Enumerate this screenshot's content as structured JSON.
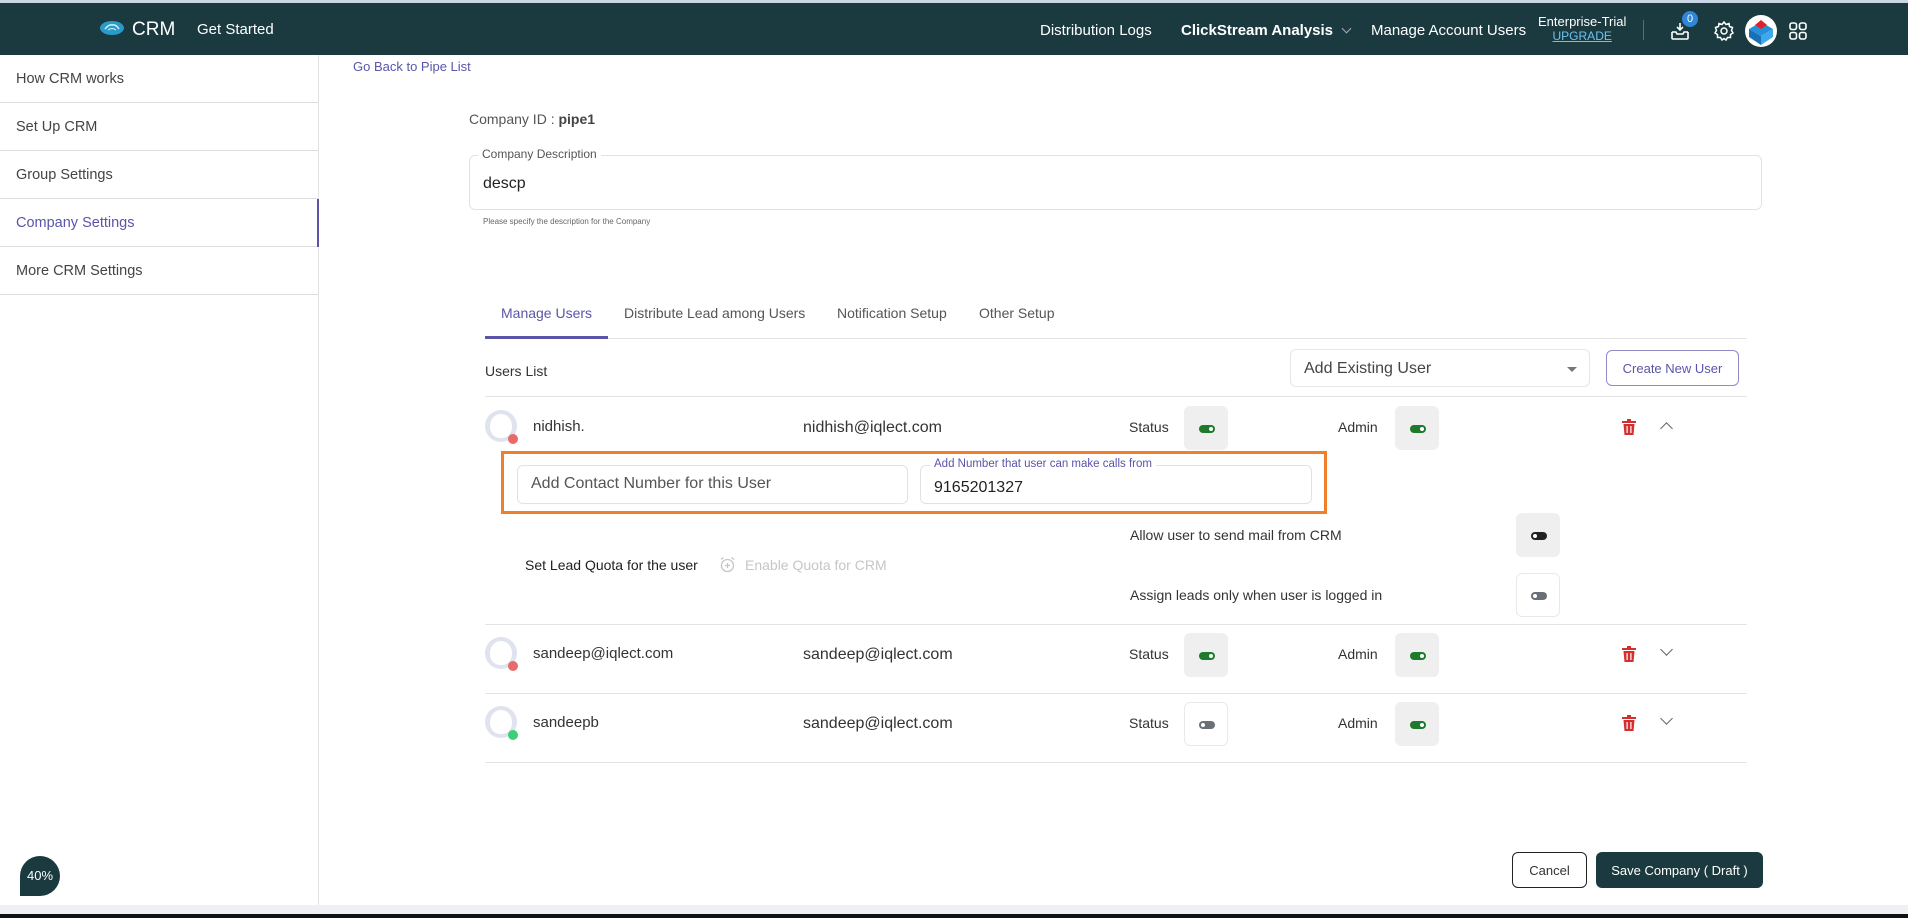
{
  "header": {
    "brand": "CRM",
    "get_started": "Get Started",
    "nav": [
      {
        "label": "Distribution Logs"
      },
      {
        "label": "ClickStream Analysis",
        "has_dropdown": true
      },
      {
        "label": "Manage Account Users"
      }
    ],
    "plan": "Enterprise-Trial",
    "upgrade": "UPGRADE",
    "notification_count": "0",
    "icons": [
      "inbox-download-icon",
      "gear-icon",
      "account-avatar",
      "apps-grid-icon"
    ]
  },
  "sidebar": {
    "items": [
      {
        "label": "How CRM works",
        "active": false
      },
      {
        "label": "Set Up CRM",
        "active": false
      },
      {
        "label": "Group Settings",
        "active": false
      },
      {
        "label": "Company Settings",
        "active": true
      },
      {
        "label": "More CRM Settings",
        "active": false
      }
    ]
  },
  "main": {
    "back_link": "Go Back to Pipe List",
    "company_id_label": "Company ID : ",
    "company_id": "pipe1",
    "description": {
      "label": "Company Description",
      "value": "descp",
      "help": "Please specify the description for the Company"
    },
    "tabs": [
      {
        "label": "Manage Users",
        "active": true
      },
      {
        "label": "Distribute Lead among Users",
        "active": false
      },
      {
        "label": "Notification Setup",
        "active": false
      },
      {
        "label": "Other Setup",
        "active": false
      }
    ],
    "users_list": {
      "title": "Users List",
      "add_existing_placeholder": "Add Existing User",
      "create_button": "Create New User",
      "status_label": "Status",
      "admin_label": "Admin",
      "users": [
        {
          "name": "nidhish.",
          "email": "nidhish@iqlect.com",
          "presence": "offline",
          "status_on": true,
          "admin_on": true,
          "expanded": true
        },
        {
          "name": "sandeep@iqlect.com",
          "email": "sandeep@iqlect.com",
          "presence": "offline",
          "status_on": true,
          "admin_on": true,
          "expanded": false
        },
        {
          "name": "sandeepb",
          "email": "sandeep@iqlect.com",
          "presence": "online",
          "status_on": false,
          "admin_on": true,
          "expanded": false
        }
      ],
      "expanded_details": {
        "contact_placeholder": "Add Contact Number for this User",
        "call_number_label": "Add Number that user can make calls from",
        "call_number_value": "9165201327",
        "allow_mail_label": "Allow user to send mail from CRM",
        "allow_mail_on": false,
        "assign_logged_in_label": "Assign leads only when user is logged in",
        "assign_logged_in_on": false,
        "quota_label": "Set Lead Quota for the user",
        "quota_enable": "Enable Quota for CRM"
      }
    },
    "cancel_button": "Cancel",
    "save_button": "Save Company ( Draft )"
  },
  "progress_badge": "40%",
  "colors": {
    "header_bg": "#1a3a3f",
    "accent": "#5a55a8",
    "toggle_on": "#1e7a2c",
    "toggle_off": "#6b6f78",
    "delete": "#d32f2f",
    "highlight": "#f07f2b",
    "offline_dot": "#e86a6a",
    "online_dot": "#3ccf78"
  }
}
